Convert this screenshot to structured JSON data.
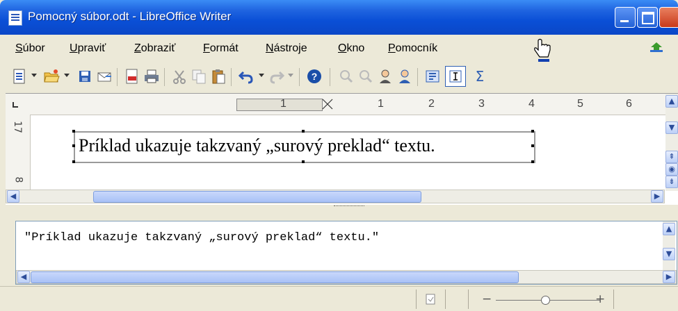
{
  "window": {
    "title": "Pomocný súbor.odt - LibreOffice Writer"
  },
  "menu": {
    "items": [
      {
        "label": "Súbor",
        "underline": "S"
      },
      {
        "label": "Upraviť",
        "underline": "U"
      },
      {
        "label": "Zobraziť",
        "underline": "Z"
      },
      {
        "label": "Formát",
        "underline": "F"
      },
      {
        "label": "Nástroje",
        "underline": "N"
      },
      {
        "label": "Okno",
        "underline": "O"
      },
      {
        "label": "Pomocník",
        "underline": "P"
      }
    ]
  },
  "toolbar": {
    "icons": [
      "new-document-icon",
      "open-folder-icon",
      "save-icon",
      "email-icon",
      "export-pdf-icon",
      "print-icon",
      "cut-icon",
      "copy-icon",
      "paste-icon",
      "undo-icon",
      "redo-icon",
      "help-icon",
      "zoom-in-icon",
      "zoom-out-icon",
      "find-icon",
      "navigator-icon",
      "styles-icon",
      "text-cursor-icon",
      "sum-icon"
    ]
  },
  "ruler": {
    "top_numbers": [
      "1",
      "1",
      "2",
      "3",
      "4",
      "5",
      "6"
    ],
    "left_numbers": [
      "17",
      "8"
    ]
  },
  "document": {
    "text": "Príklad ukazuje takzvaný „surový preklad“ textu."
  },
  "edit_field": {
    "value": "\"Príklad ukazuje takzvaný „surový preklad“ textu.\""
  },
  "statusbar": {
    "zoom_minus": "−",
    "zoom_plus": "+"
  }
}
